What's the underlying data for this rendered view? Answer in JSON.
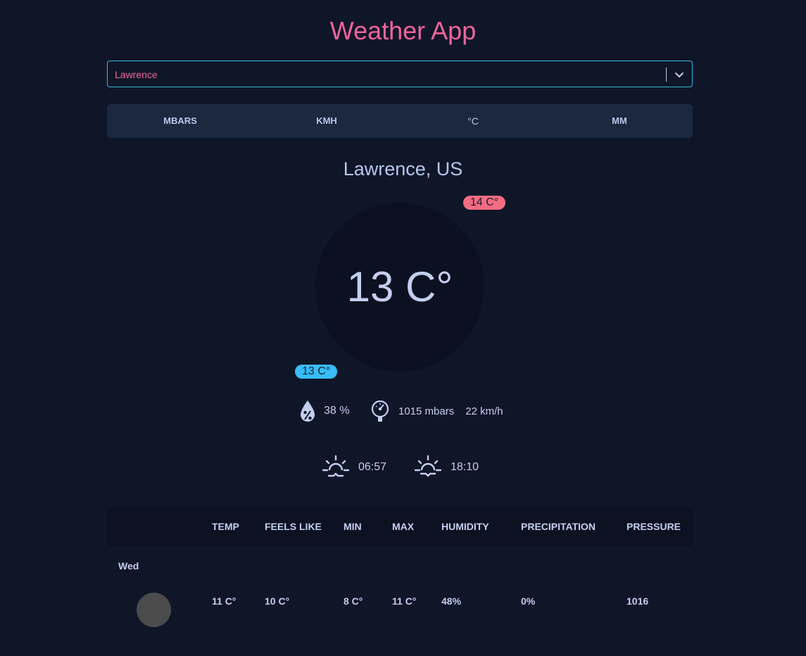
{
  "app": {
    "title": "Weather App"
  },
  "city_select": {
    "value": "Lawrence"
  },
  "units": [
    "MBARS",
    "KMH",
    "°C",
    "MM"
  ],
  "current": {
    "location": "Lawrence, US",
    "temp": "13 C°",
    "max_temp": "14 C°",
    "min_temp": "13 C°",
    "humidity": "38 %",
    "pressure": "1015 mbars",
    "wind": "22 km/h",
    "sunrise": "06:57",
    "sunset": "18:10"
  },
  "icons": {
    "humidity": "humidity-drop-icon",
    "pressure": "pressure-gauge-icon",
    "sunrise": "sunrise-icon",
    "sunset": "sunset-icon",
    "dropdown": "chevron-down-icon"
  },
  "colors": {
    "background": "#0f1628",
    "accent_pink": "#f0649b",
    "accent_blue": "#3ab8e0",
    "max_badge": "#f36c82",
    "min_badge": "#38bdf8",
    "text": "#c3cff0"
  },
  "forecast": {
    "columns": [
      "TEMP",
      "FEELS LIKE",
      "MIN",
      "MAX",
      "HUMIDITY",
      "PRECIPITATION",
      "PRESSURE"
    ],
    "rows": [
      {
        "day": "Wed",
        "values": [
          "11 C°",
          "10 C°",
          "8 C°",
          "11 C°",
          "48%",
          "0%",
          "1016"
        ]
      }
    ]
  }
}
